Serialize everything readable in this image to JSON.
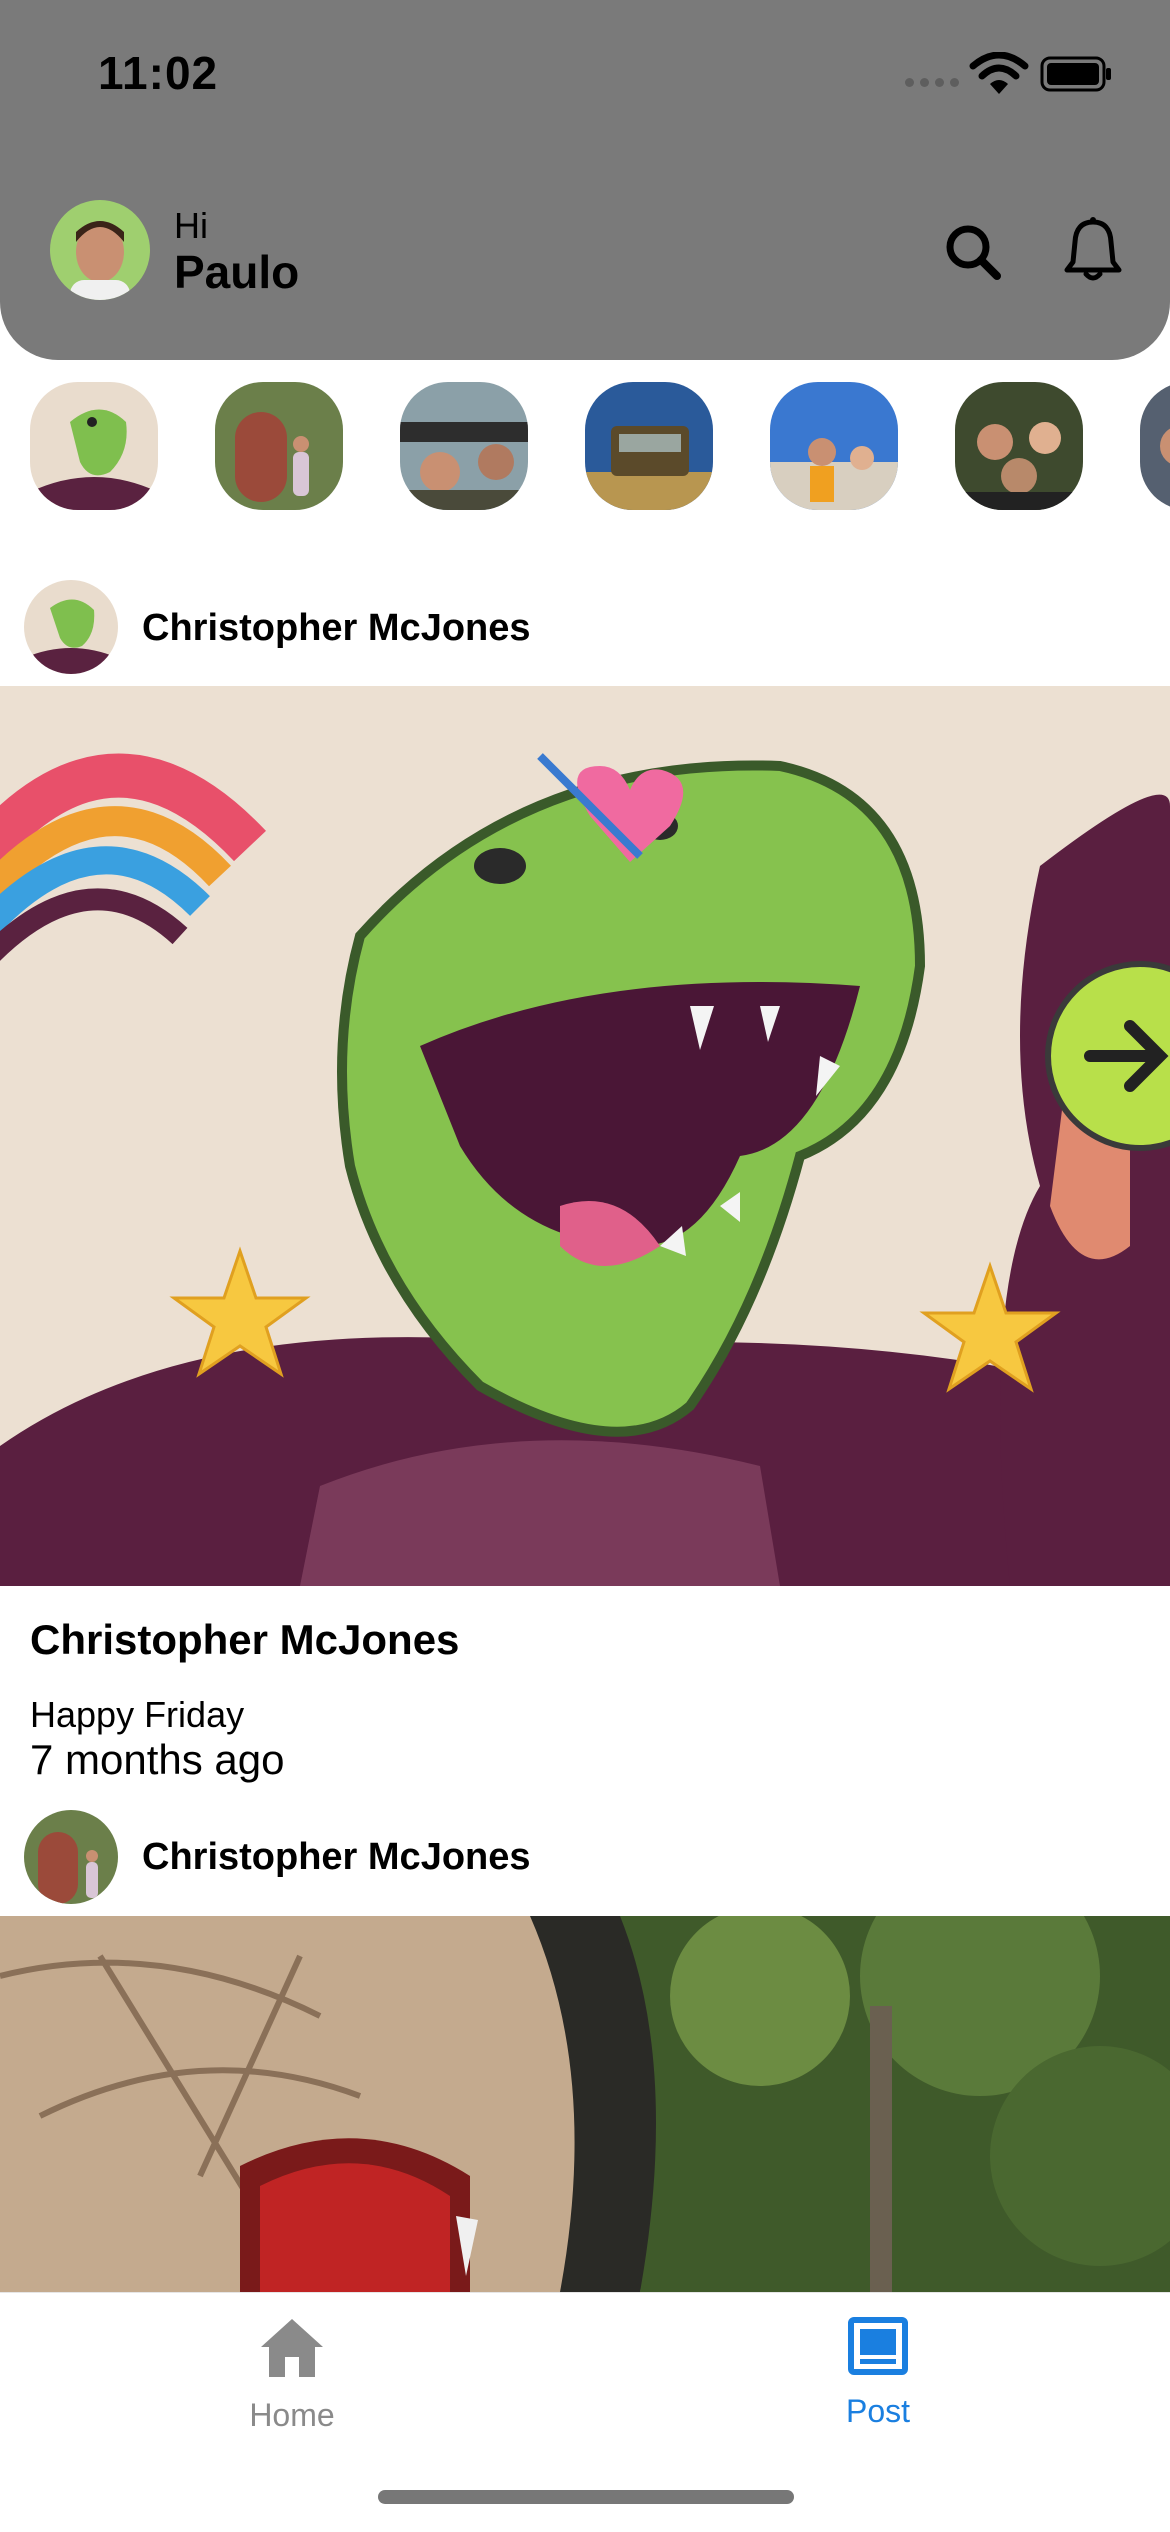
{
  "status_bar": {
    "time": "11:02"
  },
  "header": {
    "greeting": "Hi",
    "user_name": "Paulo",
    "search_icon": "search-icon",
    "notifications_icon": "bell-icon"
  },
  "stories": [
    "story-1",
    "story-2",
    "story-3",
    "story-4",
    "story-5",
    "story-6",
    "story-7"
  ],
  "feed": {
    "posts": [
      {
        "author": "Christopher McJones",
        "title": "Christopher McJones",
        "caption": "Happy Friday",
        "time": "7 months ago"
      },
      {
        "author": "Christopher McJones"
      }
    ]
  },
  "tabbar": {
    "home_label": "Home",
    "post_label": "Post",
    "active_color": "#1a7fe0",
    "inactive_color": "#8a8a8a"
  }
}
